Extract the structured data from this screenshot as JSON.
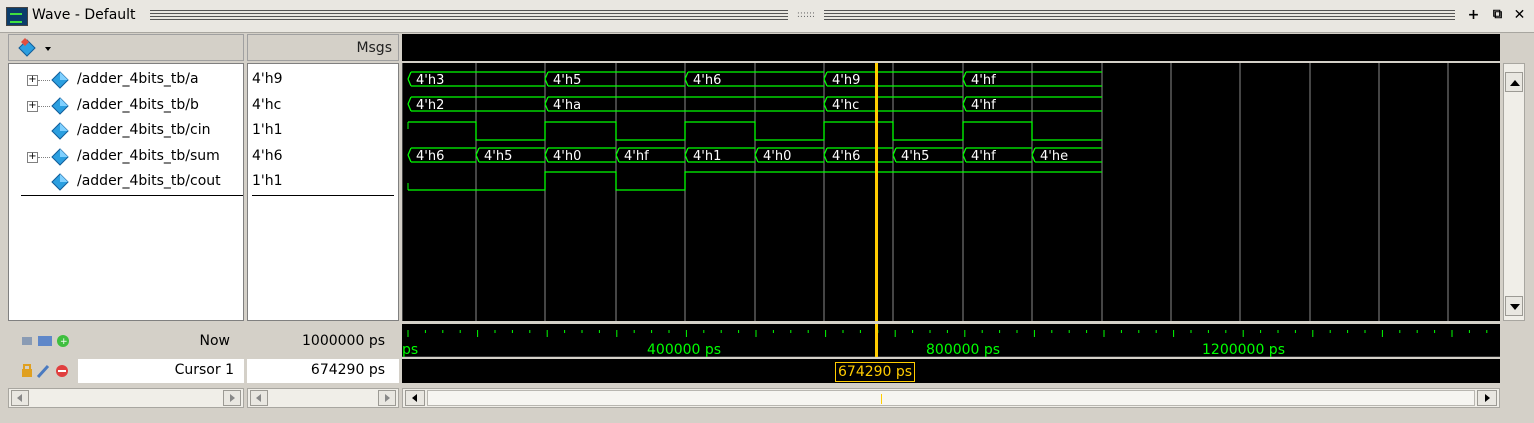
{
  "window": {
    "title": "Wave - Default",
    "grip": "::::::",
    "buttons": [
      "+",
      "⧉",
      "✕"
    ]
  },
  "header": {
    "msgs_label": "Msgs"
  },
  "signals": [
    {
      "name": "/adder_4bits_tb/a",
      "value": "4'h9",
      "expandable": true
    },
    {
      "name": "/adder_4bits_tb/b",
      "value": "4'hc",
      "expandable": true
    },
    {
      "name": "/adder_4bits_tb/cin",
      "value": "1'h1",
      "expandable": false
    },
    {
      "name": "/adder_4bits_tb/sum",
      "value": "4'h6",
      "expandable": true
    },
    {
      "name": "/adder_4bits_tb/cout",
      "value": "1'h1",
      "expandable": false
    }
  ],
  "waves": {
    "a": [
      "4'h3",
      "4'h5",
      "4'h6",
      "4'h9",
      "4'hf"
    ],
    "b": [
      "4'h2",
      "4'ha",
      "4'hc",
      "4'hf"
    ],
    "sum": [
      "4'h6",
      "4'h5",
      "4'h0",
      "4'hf",
      "4'h1",
      "4'h0",
      "4'h6",
      "4'h5",
      "4'hf",
      "4'he"
    ]
  },
  "bottom": {
    "now_label": "Now",
    "now_value": "1000000 ps",
    "cursor_label": "Cursor 1",
    "cursor_value": "674290 ps",
    "cursor_tag": "674290 ps",
    "ruler_labels": [
      "ps",
      "400000 ps",
      "800000 ps",
      "1200000 ps"
    ]
  },
  "colors": {
    "wave": "#00ff00",
    "cursor": "#ffcc00",
    "signal_icon": "#2b9fe0"
  }
}
